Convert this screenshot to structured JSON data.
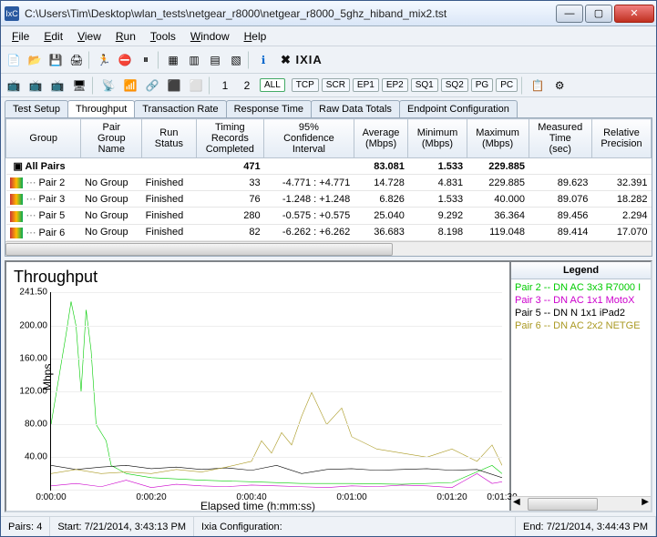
{
  "titlebar": {
    "icon_text": "IxC",
    "path": "C:\\Users\\Tim\\Desktop\\wlan_tests\\netgear_r8000\\netgear_r8000_5ghz_hiband_mix2.tst"
  },
  "menubar": [
    "File",
    "Edit",
    "View",
    "Run",
    "Tools",
    "Window",
    "Help"
  ],
  "toolbar2": {
    "all": "ALL",
    "buttons": [
      "TCP",
      "SCR",
      "EP1",
      "EP2",
      "SQ1",
      "SQ2",
      "PG",
      "PC"
    ]
  },
  "brand": {
    "pre": "",
    "x": "X",
    "post": "IXIA"
  },
  "tabs": [
    "Test Setup",
    "Throughput",
    "Transaction Rate",
    "Response Time",
    "Raw Data Totals",
    "Endpoint Configuration"
  ],
  "active_tab": 1,
  "grid": {
    "headers": [
      "Group",
      "Pair Group Name",
      "Run Status",
      "Timing Records Completed",
      "95% Confidence Interval",
      "Average (Mbps)",
      "Minimum (Mbps)",
      "Maximum (Mbps)",
      "Measured Time (sec)",
      "Relative Precision"
    ],
    "summary": {
      "group": "All Pairs",
      "records": "471",
      "avg": "83.081",
      "min": "1.533",
      "max": "229.885"
    },
    "rows": [
      {
        "pair": "Pair 2",
        "pg": "No Group",
        "status": "Finished",
        "rec": "33",
        "ci": "-4.771 : +4.771",
        "avg": "14.728",
        "min": "4.831",
        "max": "229.885",
        "meas": "89.623",
        "rp": "32.391"
      },
      {
        "pair": "Pair 3",
        "pg": "No Group",
        "status": "Finished",
        "rec": "76",
        "ci": "-1.248 : +1.248",
        "avg": "6.826",
        "min": "1.533",
        "max": "40.000",
        "meas": "89.076",
        "rp": "18.282"
      },
      {
        "pair": "Pair 5",
        "pg": "No Group",
        "status": "Finished",
        "rec": "280",
        "ci": "-0.575 : +0.575",
        "avg": "25.040",
        "min": "9.292",
        "max": "36.364",
        "meas": "89.456",
        "rp": "2.294"
      },
      {
        "pair": "Pair 6",
        "pg": "No Group",
        "status": "Finished",
        "rec": "82",
        "ci": "-6.262 : +6.262",
        "avg": "36.683",
        "min": "8.198",
        "max": "119.048",
        "meas": "89.414",
        "rp": "17.070"
      }
    ]
  },
  "chart_data": {
    "type": "line",
    "title": "Throughput",
    "ylabel": "Mbps",
    "xlabel": "Elapsed time (h:mm:ss)",
    "ylim": [
      0,
      241.5
    ],
    "yticks": [
      0,
      40,
      80,
      120,
      160,
      200,
      241.5
    ],
    "yticklabels": [
      "",
      "40.00",
      "80.00",
      "120.00",
      "160.00",
      "200.00",
      "241.50"
    ],
    "xticks": [
      0,
      20,
      40,
      60,
      80,
      90
    ],
    "xticklabels": [
      "0:00:00",
      "0:00:20",
      "0:00:40",
      "0:01:00",
      "0:01:20",
      "0:01:30"
    ],
    "series": [
      {
        "name": "Pair 2 -- DN  AC 3x3 R7000 I",
        "color": "#00cc00",
        "x": [
          0,
          3,
          4,
          5,
          6,
          7,
          8,
          9,
          10,
          11,
          12,
          15,
          20,
          30,
          40,
          50,
          60,
          70,
          80,
          88,
          90
        ],
        "y": [
          80,
          190,
          230,
          200,
          120,
          220,
          170,
          80,
          70,
          60,
          30,
          20,
          15,
          12,
          10,
          8,
          8,
          7,
          9,
          30,
          20
        ]
      },
      {
        "name": "Pair 3 -- DN AC 1x1 MotoX",
        "color": "#cc00cc",
        "x": [
          0,
          5,
          10,
          15,
          20,
          25,
          30,
          35,
          40,
          45,
          50,
          55,
          60,
          65,
          70,
          75,
          80,
          85,
          88,
          90
        ],
        "y": [
          5,
          8,
          4,
          12,
          3,
          7,
          5,
          4,
          6,
          5,
          4,
          3,
          5,
          4,
          6,
          5,
          3,
          20,
          8,
          10
        ]
      },
      {
        "name": "Pair 5 -- DN N 1x1 iPad2",
        "color": "#000000",
        "x": [
          0,
          5,
          10,
          15,
          20,
          25,
          30,
          35,
          40,
          45,
          50,
          55,
          60,
          65,
          70,
          75,
          80,
          85,
          90
        ],
        "y": [
          30,
          25,
          28,
          30,
          26,
          28,
          25,
          27,
          24,
          30,
          20,
          25,
          26,
          24,
          25,
          26,
          24,
          25,
          15
        ]
      },
      {
        "name": "Pair 6 -- DN  AC 2x2 NETGE",
        "color": "#aa9922",
        "x": [
          0,
          5,
          10,
          15,
          20,
          25,
          30,
          35,
          40,
          42,
          44,
          46,
          48,
          50,
          52,
          55,
          58,
          60,
          65,
          70,
          75,
          80,
          85,
          88,
          90
        ],
        "y": [
          20,
          25,
          20,
          22,
          20,
          25,
          22,
          28,
          35,
          60,
          45,
          70,
          55,
          90,
          119,
          80,
          100,
          65,
          50,
          45,
          40,
          50,
          35,
          55,
          30
        ]
      }
    ]
  },
  "legend_header": "Legend",
  "statusbar": {
    "pairs_label": "Pairs:",
    "pairs": "4",
    "start_label": "Start:",
    "start": "7/21/2014, 3:43:13 PM",
    "config_label": "Ixia Configuration:",
    "end_label": "End:",
    "end": "7/21/2014, 3:44:43 PM"
  }
}
